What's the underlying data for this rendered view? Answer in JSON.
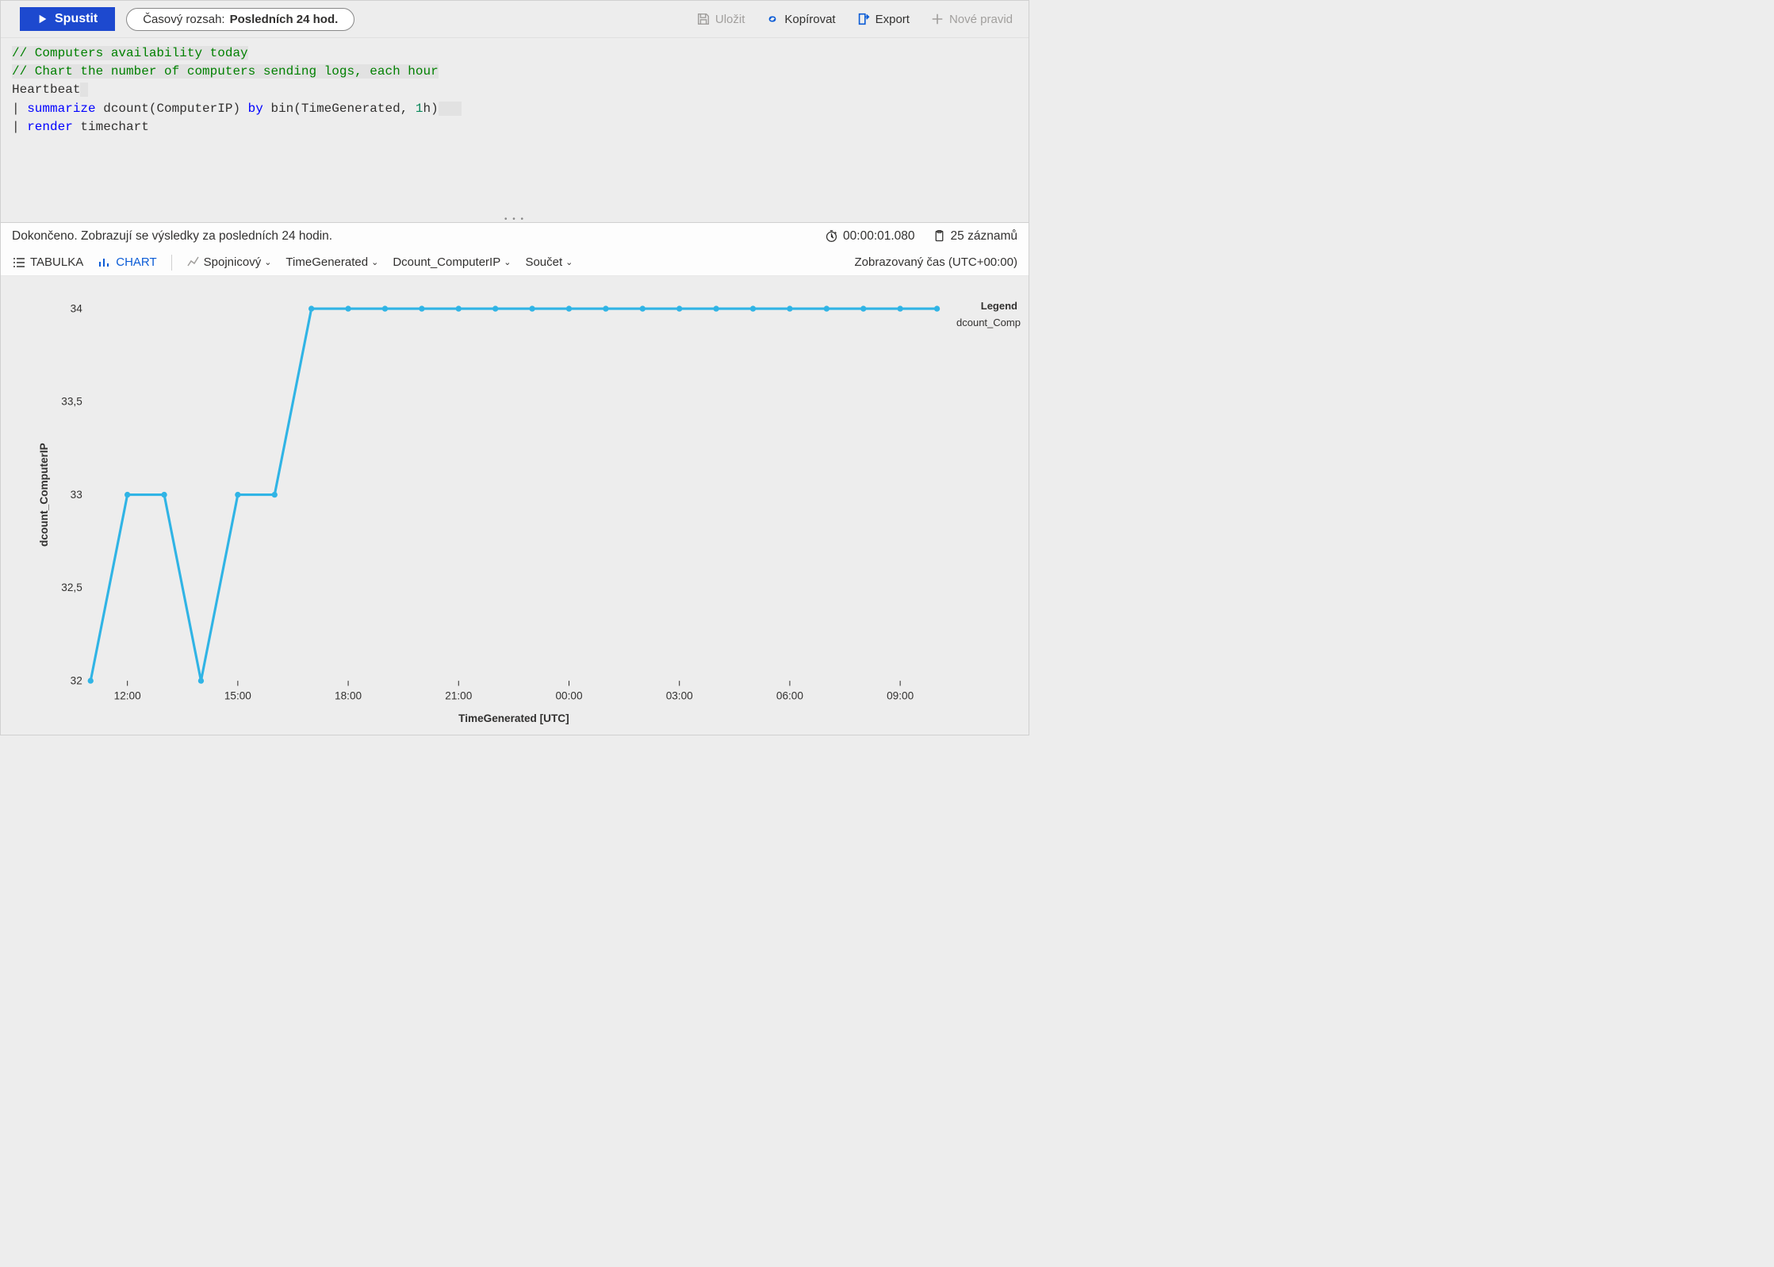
{
  "toolbar": {
    "run_label": "Spustit",
    "timerange_prefix": "Časový rozsah: ",
    "timerange_value": "Posledních 24 hod.",
    "save_label": "Uložit",
    "copy_label": "Kopírovat",
    "export_label": "Export",
    "new_rule_label": "Nové pravid"
  },
  "editor": {
    "lines": [
      {
        "tokens": [
          {
            "cls": "tok-comment hl",
            "t": "// Computers availability today"
          }
        ]
      },
      {
        "tokens": [
          {
            "cls": "tok-comment hl",
            "t": "// Chart the number of computers sending logs, each hour"
          }
        ]
      },
      {
        "tokens": [
          {
            "cls": "tok-plain",
            "t": "Heartbeat"
          },
          {
            "cls": "hl",
            "t": " "
          }
        ]
      },
      {
        "tokens": [
          {
            "cls": "tok-plain",
            "t": "| "
          },
          {
            "cls": "tok-kw",
            "t": "summarize"
          },
          {
            "cls": "tok-plain",
            "t": " dcount(ComputerIP) "
          },
          {
            "cls": "tok-kw",
            "t": "by"
          },
          {
            "cls": "tok-plain",
            "t": " bin(TimeGenerated, "
          },
          {
            "cls": "tok-num",
            "t": "1"
          },
          {
            "cls": "tok-plain",
            "t": "h)"
          },
          {
            "cls": "hl",
            "t": "   "
          }
        ]
      },
      {
        "tokens": [
          {
            "cls": "tok-plain",
            "t": "| "
          },
          {
            "cls": "tok-kw",
            "t": "render"
          },
          {
            "cls": "tok-plain",
            "t": " timechart"
          }
        ]
      }
    ]
  },
  "status": {
    "message": "Dokončeno. Zobrazují se výsledky za posledních 24 hodin.",
    "elapsed": "00:00:01.080",
    "records": "25 záznamů"
  },
  "resultbar": {
    "table_label": "TABULKA",
    "chart_label": "CHART",
    "chart_type": "Spojnicový",
    "x_field": "TimeGenerated",
    "y_field": "Dcount_ComputerIP",
    "agg": "Součet",
    "tz_label": "Zobrazovaný čas (UTC+00:00)"
  },
  "legend": {
    "title": "Legend",
    "series": "dcount_Compu"
  },
  "chart_data": {
    "type": "line",
    "title": "",
    "xlabel": "TimeGenerated [UTC]",
    "ylabel": "dcount_ComputerIP",
    "ylim": [
      32,
      34
    ],
    "y_ticks": [
      32,
      32.5,
      33,
      33.5,
      34
    ],
    "y_tick_labels": [
      "32",
      "32,5",
      "33",
      "33,5",
      "34"
    ],
    "x_tick_labels": [
      "12:00",
      "15:00",
      "18:00",
      "21:00",
      "00:00",
      "03:00",
      "06:00",
      "09:00"
    ],
    "x_tick_indices": [
      1,
      4,
      7,
      10,
      13,
      16,
      19,
      22
    ],
    "series": [
      {
        "name": "dcount_ComputerIP",
        "color": "#30b4e5",
        "x": [
          "11:00",
          "12:00",
          "13:00",
          "14:00",
          "15:00",
          "16:00",
          "17:00",
          "18:00",
          "19:00",
          "20:00",
          "21:00",
          "22:00",
          "23:00",
          "00:00",
          "01:00",
          "02:00",
          "03:00",
          "04:00",
          "05:00",
          "06:00",
          "07:00",
          "08:00",
          "09:00",
          "10:00"
        ],
        "values": [
          32,
          33,
          33,
          32,
          33,
          33,
          34,
          34,
          34,
          34,
          34,
          34,
          34,
          34,
          34,
          34,
          34,
          34,
          34,
          34,
          34,
          34,
          34,
          34
        ]
      }
    ]
  }
}
